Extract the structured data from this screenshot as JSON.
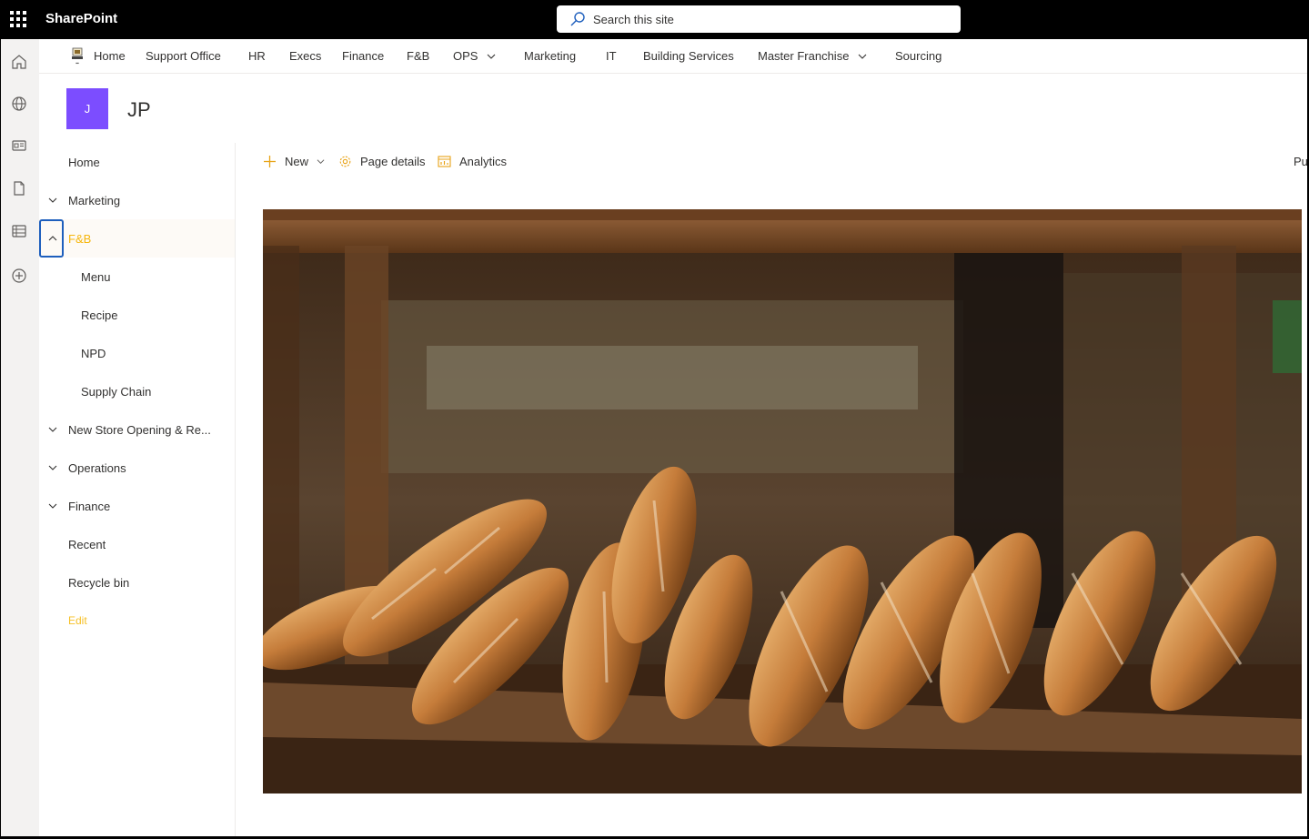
{
  "suite": {
    "brand": "SharePoint",
    "search_placeholder": "Search this site"
  },
  "appbar": [
    "home-icon",
    "globe-icon",
    "news-icon",
    "document-icon",
    "list-icon",
    "add-icon"
  ],
  "hub_nav": {
    "items": [
      {
        "label": "Home"
      },
      {
        "label": "Support Office"
      },
      {
        "label": "HR"
      },
      {
        "label": "Execs"
      },
      {
        "label": "Finance"
      },
      {
        "label": "F&B"
      },
      {
        "label": "OPS",
        "has_dropdown": true
      },
      {
        "label": "Marketing"
      },
      {
        "label": "IT"
      },
      {
        "label": "Building Services"
      },
      {
        "label": "Master Franchise",
        "has_dropdown": true
      },
      {
        "label": "Sourcing"
      }
    ]
  },
  "site": {
    "logo_letter": "J",
    "title": "JP",
    "logo_color": "#7c4dff"
  },
  "left_nav": {
    "items": [
      {
        "label": "Home"
      },
      {
        "label": "Marketing",
        "collapsible": true,
        "expanded": false
      },
      {
        "label": "F&B",
        "collapsible": true,
        "expanded": true,
        "active": true
      },
      {
        "label": "Menu",
        "level": 2
      },
      {
        "label": "Recipe",
        "level": 2
      },
      {
        "label": "NPD",
        "level": 2
      },
      {
        "label": "Supply Chain",
        "level": 2
      },
      {
        "label": "New Store Opening & Re...",
        "collapsible": true,
        "expanded": false
      },
      {
        "label": "Operations",
        "collapsible": true,
        "expanded": false
      },
      {
        "label": "Finance",
        "collapsible": true,
        "expanded": false
      },
      {
        "label": "Recent"
      },
      {
        "label": "Recycle bin"
      }
    ],
    "edit_label": "Edit",
    "accent_color": "#f6b60d"
  },
  "command_bar": {
    "new_label": "New",
    "page_details_label": "Page details",
    "analytics_label": "Analytics",
    "publish_label": "Pu"
  },
  "hero": {
    "subject": "baguettes on wooden bakery shelf"
  }
}
